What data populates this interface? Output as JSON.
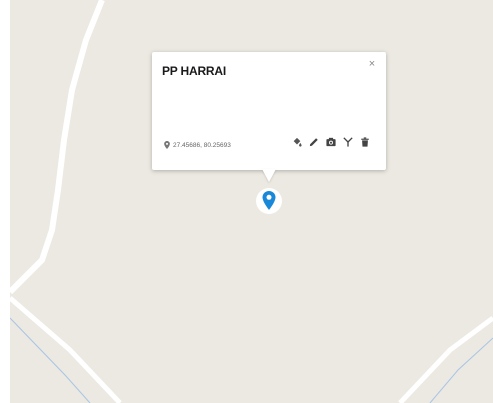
{
  "popup": {
    "title": "PP HARRAI",
    "close_label": "×",
    "coordinates": "27.45686, 80.25693"
  },
  "icons": {
    "fill": "paint-bucket-icon",
    "edit": "pencil-icon",
    "photo": "camera-icon",
    "antenna": "antenna-icon",
    "delete": "trash-icon",
    "location": "map-marker-icon"
  },
  "colors": {
    "map_background": "#ebe9e1",
    "road": "#ffffff",
    "water_line": "#a8c4e6",
    "marker": "#1a88d8"
  }
}
